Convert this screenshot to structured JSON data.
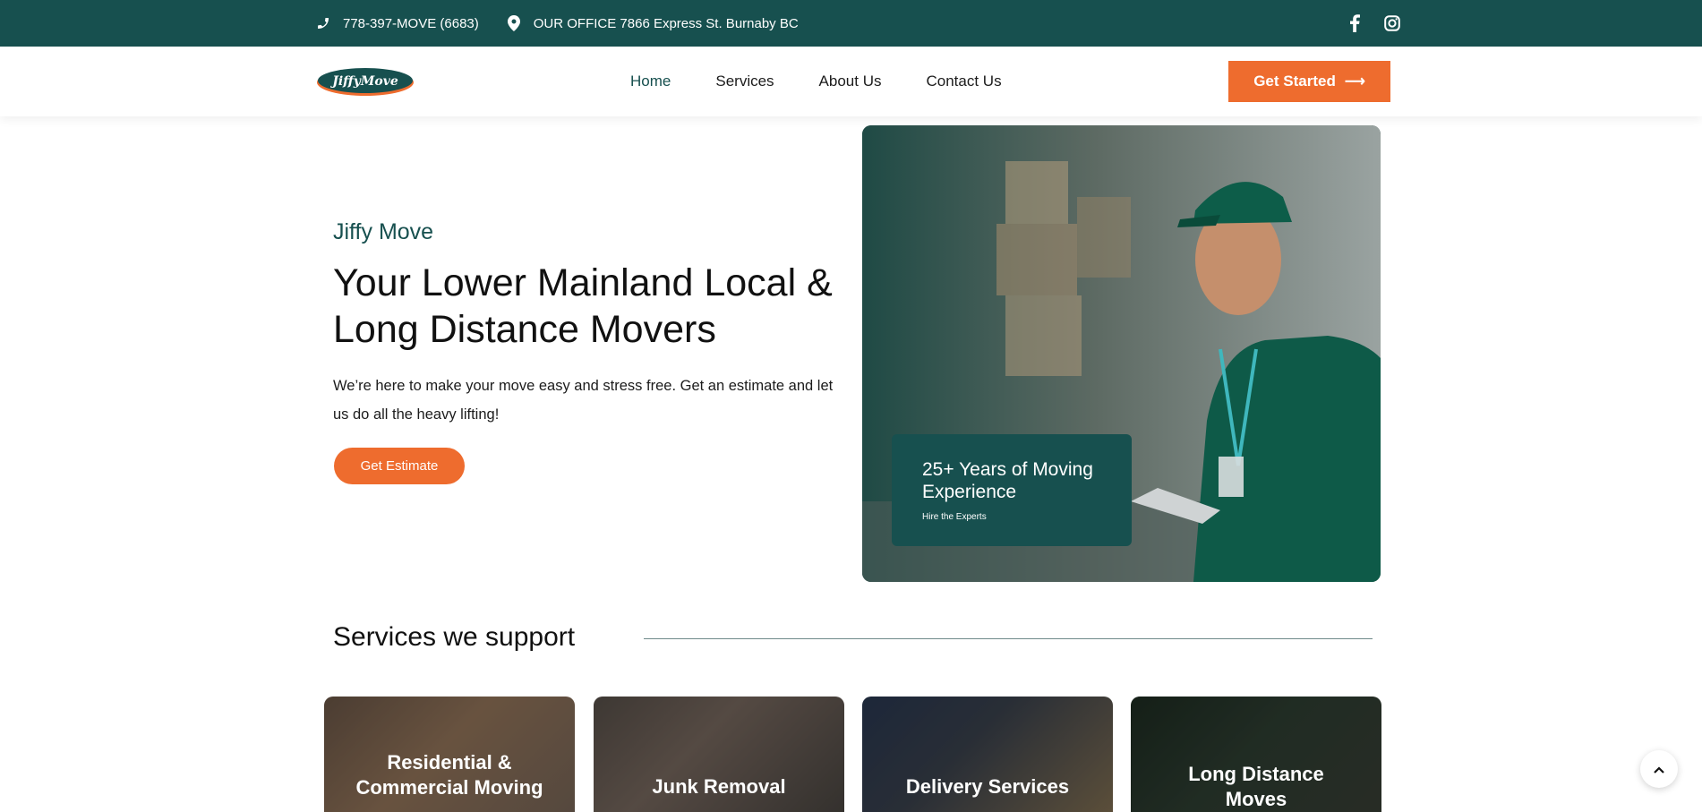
{
  "topbar": {
    "phone": "778-397-MOVE (6683)",
    "office": "OUR OFFICE 7866 Express St. Burnaby BC",
    "social": [
      "facebook-icon",
      "instagram-icon"
    ]
  },
  "header": {
    "logo_text": "JiffyMove",
    "nav": [
      "Home",
      "Services",
      "About Us",
      "Contact Us"
    ],
    "active_nav": "Home",
    "cta_label": "Get Started"
  },
  "hero": {
    "eyebrow": "Jiffy Move",
    "title": "Your Lower Mainland Local & Long Distance Movers",
    "text": " We’re here to make your move easy and stress free. Get an estimate and let us do all the heavy lifting!",
    "button": "Get Estimate",
    "badge_title": "25+ Years of Moving Experience",
    "badge_sub": "Hire the Experts"
  },
  "services": {
    "title": "Services we support",
    "cards": [
      "Residential & Commercial Moving",
      "Junk Removal",
      "Delivery Services",
      "Long Distance Moves"
    ]
  },
  "colors": {
    "brand_dark": "#17504f",
    "accent": "#ee6c2e"
  }
}
